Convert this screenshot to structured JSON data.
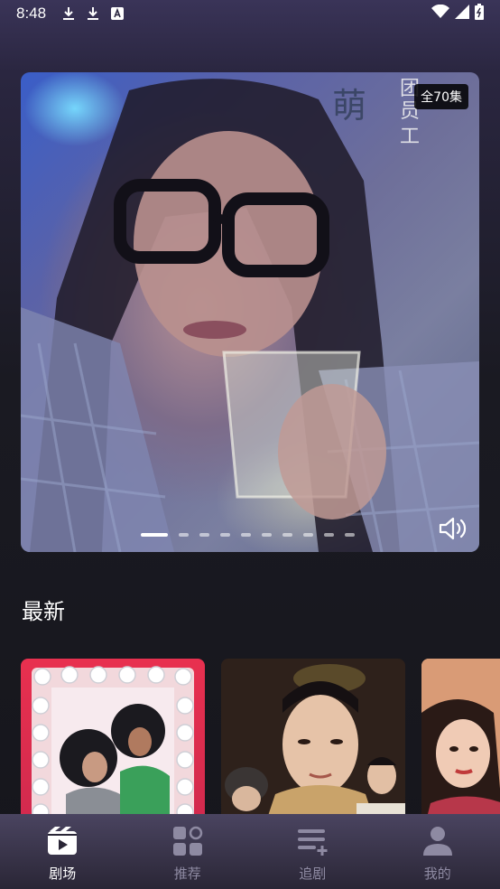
{
  "status_bar": {
    "time": "8:48",
    "icons_left": [
      "download-icon",
      "download-icon",
      "a-box-icon"
    ],
    "icons_right": [
      "wifi-icon",
      "signal-icon",
      "battery-icon"
    ]
  },
  "banner": {
    "episode_badge": "全70集",
    "overlay_text": [
      "萌",
      "团",
      "员",
      "工"
    ],
    "dot_count": 10,
    "active_dot": 0,
    "volume_icon": "volume-icon"
  },
  "latest": {
    "title": "最新"
  },
  "tabs": [
    {
      "label": "剧场",
      "icon": "clapperboard-icon",
      "active": true
    },
    {
      "label": "推荐",
      "icon": "grid-icon",
      "active": false
    },
    {
      "label": "追剧",
      "icon": "playlist-add-icon",
      "active": false
    },
    {
      "label": "我的",
      "icon": "profile-icon",
      "active": false
    }
  ],
  "colors": {
    "tab_active": "#ffffff",
    "tab_inactive": "#8e8aa2",
    "card_red": "#e8304f"
  }
}
